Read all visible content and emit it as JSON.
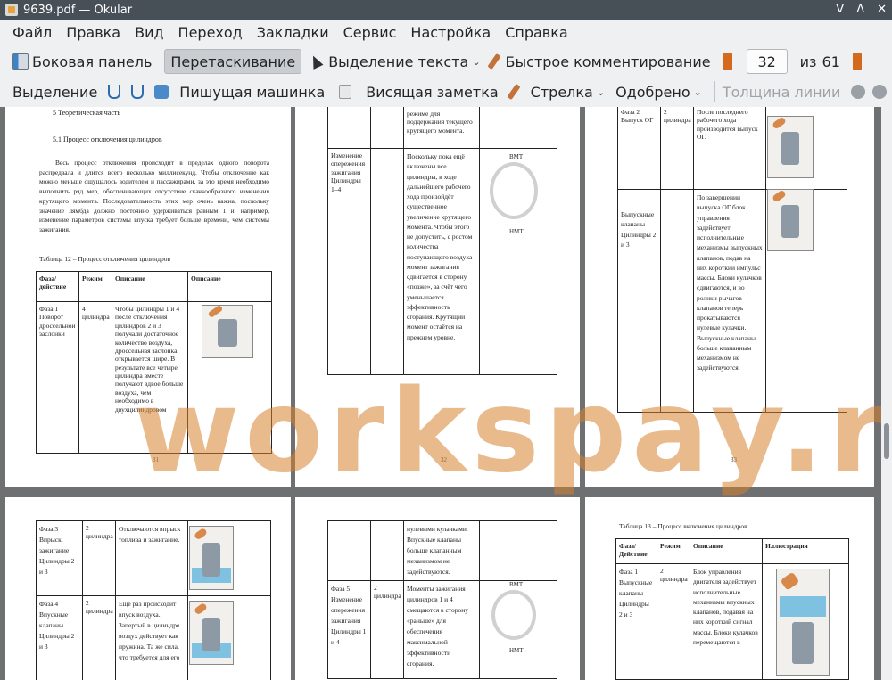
{
  "window": {
    "title": "9639.pdf — Okular",
    "controls": [
      "ᐯ",
      "ᐱ",
      "✕"
    ]
  },
  "menu": [
    "Файл",
    "Правка",
    "Вид",
    "Переход",
    "Закладки",
    "Сервис",
    "Настройка",
    "Справка"
  ],
  "toolbar1": {
    "sidebar": "Боковая панель",
    "drag": "Перетаскивание",
    "text_select": "Выделение текста",
    "quick_comment": "Быстрое комментирование",
    "page_current": "32",
    "page_of": "из",
    "page_total": "61"
  },
  "toolbar2": {
    "select": "Выделение",
    "typewriter": "Пишущая машинка",
    "note": "Висящая заметка",
    "arrow": "Стрелка",
    "approved": "Одобрено",
    "line_width": "Толщина линии"
  },
  "watermark": "workspay.ru",
  "page31": {
    "heading": "5 Теоретическая часть",
    "subheading": "5.1 Процесс отключения цилиндров",
    "para": "Весь процесс отключения происходит в пределах одного поворота распредвала и длится всего несколько миллисекунд. Чтобы отключение как можно меньше ощущалось водителем и пассажирами, за это время необходимо выполнить ряд мер, обеспечивающих отсутствие скачкообразного изменения крутящего момента. Последовательность этих мер очень важна, поскольку значение лямбда должно постоянно удерживаться равным 1 и, например, изменение параметров системы впуска требует больше времени, чем системы зажигания.",
    "table_caption": "Таблица 12 – Процесс отключения цилиндров",
    "headers": [
      "Фаза/ действие",
      "Режим",
      "Описание",
      "Описание"
    ],
    "row": [
      "Фаза 1 Поворот дроссельной заслонки",
      "4 цилиндра",
      "Чтобы цилиндры 1 и 4 после отключения цилиндров 2 и 3 получали достаточное количество воздуха, дроссельная заслонка открывается шире. В результате все четыре цилиндра вместе получают вдвое больше воздуха, чем необходимо в двухцилиндровом"
    ],
    "num": "31"
  },
  "page32": {
    "top_desc": "режиме для поддержания текущего крутящего момента.",
    "row_phase": "Изменение опережения зажигания Цилиндры 1–4",
    "row_desc": "Поскольку пока ещё включены все цилиндры, в ходе дальнейшего рабочего хода произойдёт существенное увеличение крутящего момента. Чтобы этого не допустить, с ростом количества поступающего воздуха момент зажигания сдвигается в сторону «позже», за счёт чего уменьшается эффективность сгорания. Крутящий момент остаётся на прежнем уровне.",
    "vmt": "ВМТ",
    "nmt": "НМТ",
    "num": "32"
  },
  "page33": {
    "phase": "Фаза 2 Выпуск ОГ",
    "mode": "2 цилиндра",
    "desc1": "После последнего рабочего хода производится выпуск ОГ.",
    "phase2": "Выпускные клапаны Цилиндры 2 и 3",
    "desc2": "По завершении выпуска ОГ блок управления задействует исполнительные механизмы выпускных клапанов, подав на них короткий импульс массы. Блоки кулачков сдвигаются, и во ролики рычагов клапанов теперь прокатываются нулевые кулачки. Выпускные клапаны больше клапанным механизмом не задействуются.",
    "num": "33"
  },
  "page34": {
    "r1": [
      "Фаза 3 Впрыск, зажигание Цилиндры 2 и 3",
      "2 цилиндра",
      "Отключаются впрыск топлива и зажигание."
    ],
    "r2": [
      "Фаза 4 Впускные клапаны Цилиндры 2 и 3",
      "2 цилиндра",
      "Ещё раз происходит впуск воздуха. Запертый в цилиндре воздух действует как пружина. Та же сила, что требуется для его"
    ]
  },
  "page35": {
    "top": "нулевыми кулачками. Впускные клапаны больше клапанным механизмом не задействуются.",
    "phase": "Фаза 5 Изменение опережения зажигания Цилиндры 1 и 4",
    "mode": "2 цилиндра",
    "desc": "Моменты зажигания цилиндров 1 и 4 смещаются в сторону «раньше» для обеспечения максимальной эффективности сгорания.",
    "vmt": "ВМТ",
    "nmt": "НМТ"
  },
  "page36": {
    "caption": "Таблица 13 – Процесс включения цилиндров",
    "headers": [
      "Фаза/ Действие",
      "Режим",
      "Описание",
      "Иллюстрация"
    ],
    "row": [
      "Фаза 1 Выпускные клапаны Цилиндры 2 и 3",
      "2 цилиндра",
      "Блок управления двигателя задействует исполнительные механизмы впускных клапанов, подавая на них короткий сигнал массы. Блоки кулачков перемещаются в"
    ]
  }
}
